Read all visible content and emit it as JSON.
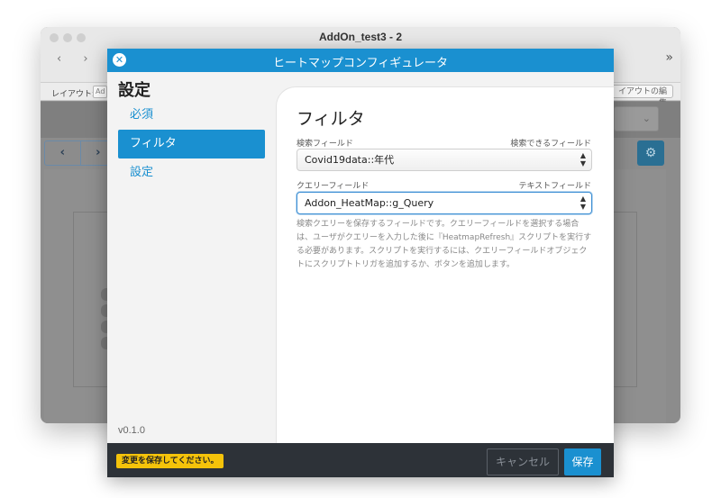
{
  "window": {
    "title": "AddOn_test3 - 2",
    "nav_arrows": "‹ ›",
    "more": "»",
    "layout_label": "レイアウト:",
    "layout_value": "Ad",
    "layout_edit": "イアウトの編集",
    "dropdown_chevron": "⌄",
    "prev": "‹",
    "next": "›",
    "gear": "⚙"
  },
  "modal": {
    "title": "ヒートマップコンフィギュレータ",
    "close": "✕"
  },
  "sidebar": {
    "heading": "設定",
    "items": [
      {
        "label": "必須"
      },
      {
        "label": "フィルタ"
      },
      {
        "label": "設定"
      }
    ],
    "version": "v0.1.0"
  },
  "content": {
    "title": "フィルタ",
    "search_field": {
      "label": "検索フィールド",
      "hint": "検索できるフィールド",
      "value": "Covid19data::年代"
    },
    "query_field": {
      "label": "クエリーフィールド",
      "hint": "テキストフィールド",
      "value": "Addon_HeatMap::g_Query"
    },
    "description": "検索クエリーを保存するフィールドです。クエリーフィールドを選択する場合は、ユーザがクエリーを入力した後に『HeatmapRefresh』スクリプトを実行する必要があります。スクリプトを実行するには、クエリーフィールドオブジェクトにスクリプトトリガを追加するか、ボタンを追加します。"
  },
  "footer": {
    "notice": "変更を保存してください。",
    "cancel": "キャンセル",
    "save": "保存"
  },
  "colors": {
    "accent": "#1a90d0",
    "notice": "#f5c30a",
    "footer_bg": "#2d3238"
  }
}
